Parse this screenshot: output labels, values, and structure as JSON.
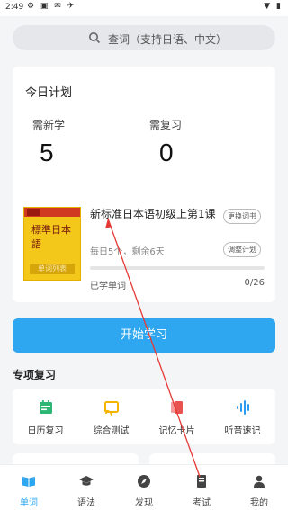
{
  "status_bar": {
    "time": "2:49"
  },
  "search": {
    "placeholder": "查词（支持日语、中文）"
  },
  "plan": {
    "title": "今日计划",
    "new_label": "需新学",
    "new_count": "5",
    "review_label": "需复习",
    "review_count": "0",
    "book": {
      "cover_text": "標準日本語",
      "cover_caption": "单词列表",
      "title": "新标准日本语初级上第1课",
      "change_label": "更换词书",
      "daily": "每日5个，剩余6天",
      "adjust_label": "调整计划",
      "progress": 0,
      "learned_label": "已学单词",
      "count": "0/26"
    }
  },
  "start_button": "开始学习",
  "special_section": {
    "title": "专项复习",
    "items": [
      {
        "label": "日历复习",
        "icon": "calendar-icon",
        "color": "#2bb673"
      },
      {
        "label": "综合测试",
        "icon": "cast-icon",
        "color": "#f5b400"
      },
      {
        "label": "记忆卡片",
        "icon": "flashcard-icon",
        "color": "#e8524f"
      },
      {
        "label": "听音速记",
        "icon": "audio-wave-icon",
        "color": "#2d9cf0"
      }
    ]
  },
  "bottom_nav": [
    {
      "label": "单词",
      "icon": "book-open-icon",
      "active": true
    },
    {
      "label": "语法",
      "icon": "graduation-cap-icon",
      "active": false
    },
    {
      "label": "发现",
      "icon": "compass-icon",
      "active": false
    },
    {
      "label": "考试",
      "icon": "exam-icon",
      "active": false
    },
    {
      "label": "我的",
      "icon": "user-icon",
      "active": false
    }
  ],
  "colors": {
    "accent": "#2ea7f0",
    "annotation_arrow": "#e53935"
  }
}
